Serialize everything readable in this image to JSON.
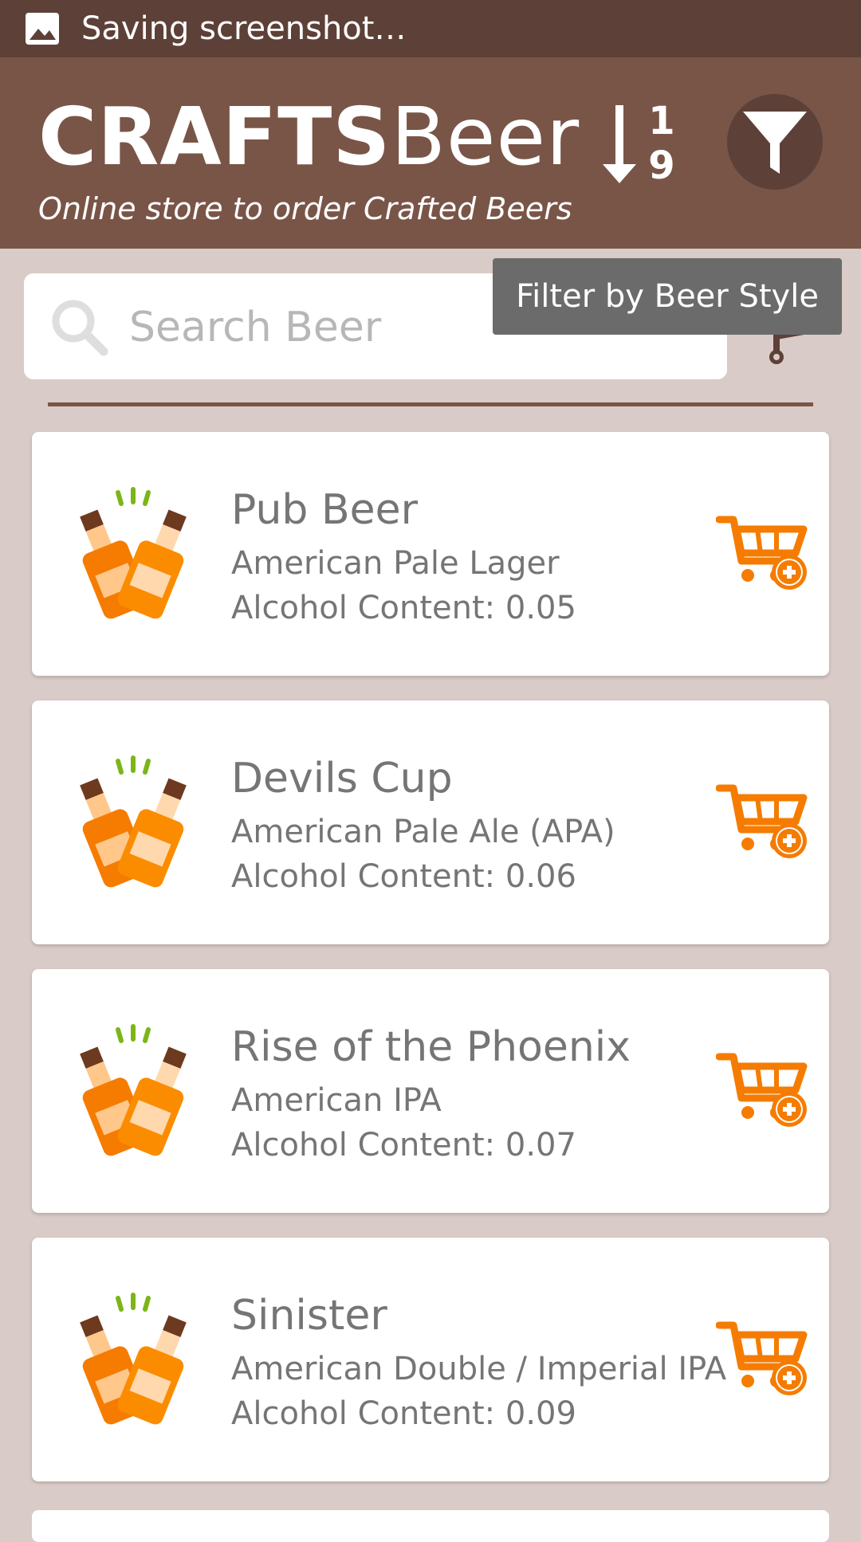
{
  "status_bar": {
    "text": "Saving screenshot…",
    "icon": "image-icon"
  },
  "header": {
    "brand_bold": "CRAFTS",
    "brand_light": "Beer",
    "subtitle": "Online store to order Crafted Beers",
    "sort_icon": "sort-numeric-down-icon",
    "sort_digit_top": "1",
    "sort_digit_bottom": "9",
    "filter_icon": "filter-icon"
  },
  "search": {
    "placeholder": "Search Beer",
    "icon": "search-icon"
  },
  "tooltip": {
    "text": "Filter by Beer Style"
  },
  "cart": {
    "icon": "cart-dolly-icon"
  },
  "beers": [
    {
      "name": "Pub Beer",
      "style": "American Pale Lager",
      "alcohol": "Alcohol Content: 0.05"
    },
    {
      "name": "Devils Cup",
      "style": "American Pale Ale (APA)",
      "alcohol": "Alcohol Content: 0.06"
    },
    {
      "name": "Rise of the Phoenix",
      "style": "American IPA",
      "alcohol": "Alcohol Content: 0.07"
    },
    {
      "name": "Sinister",
      "style": "American Double / Imperial IPA",
      "alcohol": "Alcohol Content: 0.09"
    }
  ],
  "colors": {
    "status_bar": "#5d4037",
    "app_bar": "#795548",
    "background": "#d9cbc7",
    "accent_orange": "#f57c00",
    "text_gray": "#757575"
  }
}
